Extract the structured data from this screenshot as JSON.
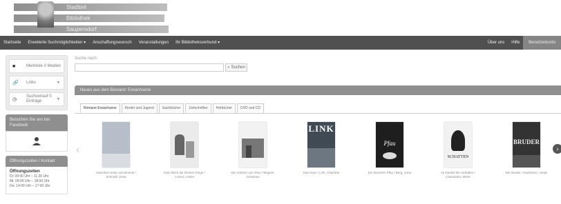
{
  "logo": {
    "line1": "Stadtteil",
    "line2": "Bibliothek",
    "line3": "Saupersdorf"
  },
  "nav": {
    "items": [
      "Startseite",
      "Erweiterte Suchmöglichkeiten",
      "Anschaffungswunsch",
      "Veranstaltungen",
      "Ihr Bibliotheksverbund"
    ],
    "right": [
      "Über uns",
      "Hilfe"
    ],
    "login": "Benutzerkonto"
  },
  "sidebar": {
    "merkliste": "Merkliste 0 Medien",
    "language": "Links",
    "bookmark": "Suchverlauf 0 Einträge",
    "social_head": "Besuchen Sie uns bei Facebook",
    "hours_head": "Öffnungszeiten / Kontakt",
    "hours_title": "Öffnungszeiten",
    "hours_lines": [
      "Di: 09:00 Uhr – 11:30 Uhr",
      "Mi: 09:00 Uhr – 18:00 Uhr",
      "Do: 14:00 Uhr – 17:00 Uhr"
    ]
  },
  "search": {
    "label": "Suche nach:",
    "button": "Suchen",
    "placeholder": ""
  },
  "carousel": {
    "title": "Neues aus dem Bestand: Erwachsene",
    "tabs": [
      "Romane Erwachsene",
      "Kinder und Jugend",
      "Sachbücher",
      "Zeitschriften",
      "Hörbücher",
      "DVD und CD"
    ],
    "active_tab": 0,
    "books": [
      {
        "caption": "Zwischen Erde und Himmel / Schmidt, Anna",
        "cover_title": "",
        "bg": "#b5bec9"
      },
      {
        "caption": "Das Glück der kleinen Dinge / Lorenz, Katrin",
        "cover_title": "",
        "bg": "#e8e8e8"
      },
      {
        "caption": "Der Gärtner von Otsu / Wagner, Johannes",
        "cover_title": "",
        "bg": "#f2f2f2"
      },
      {
        "caption": "Das Haus / Link, Charlotte",
        "cover_title": "LINK",
        "bg": "#3f4a55"
      },
      {
        "caption": "Ein bisschen Pfau / Berg, Anna",
        "cover_title": "Pfau",
        "bg": "#1e1e1e"
      },
      {
        "caption": "Im Dunkel der Schatten / Cassandra, Marie",
        "cover_title": "SCHATTEN",
        "bg": "#f2f2f2"
      },
      {
        "caption": "Der Bruder / Kaufmann, Jonas",
        "cover_title": "BRUDER",
        "bg": "#333333"
      }
    ]
  }
}
